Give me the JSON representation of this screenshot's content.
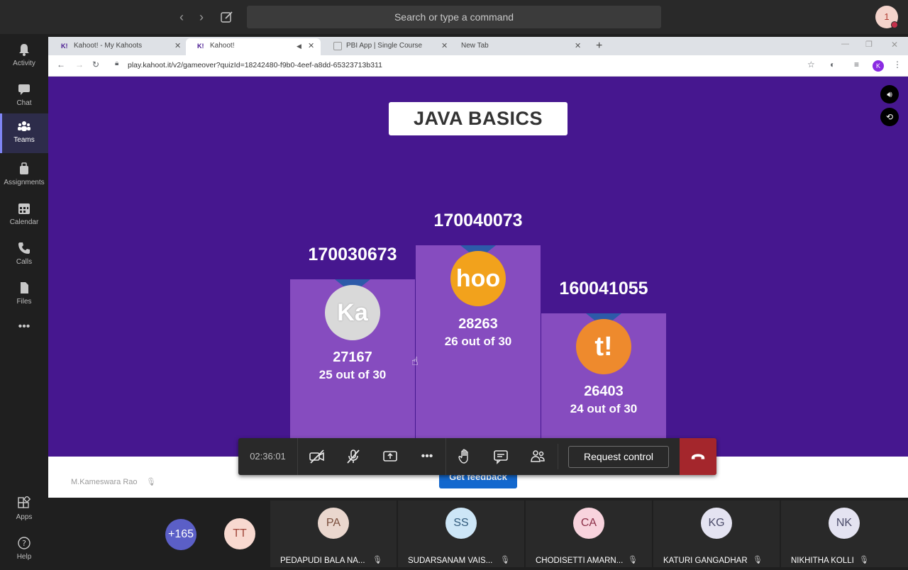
{
  "teams": {
    "search_placeholder": "Search or type a command",
    "avatar_initial": "1",
    "rail": [
      {
        "label": "Activity",
        "icon": "bell-icon"
      },
      {
        "label": "Chat",
        "icon": "chat-icon"
      },
      {
        "label": "Teams",
        "icon": "teams-icon",
        "active": true
      },
      {
        "label": "Assignments",
        "icon": "assignments-icon"
      },
      {
        "label": "Calendar",
        "icon": "calendar-icon"
      },
      {
        "label": "Calls",
        "icon": "phone-icon"
      },
      {
        "label": "Files",
        "icon": "files-icon"
      },
      {
        "label": "Apps",
        "icon": "apps-icon"
      },
      {
        "label": "Help",
        "icon": "help-icon"
      }
    ],
    "more_glyph": "•••"
  },
  "browser": {
    "tabs": [
      {
        "label": "Kahoot! - My Kahoots",
        "favicon": "K!"
      },
      {
        "label": "Kahoot!",
        "favicon": "K!"
      },
      {
        "label": "PBI App | Single Course",
        "favicon": ""
      },
      {
        "label": "New Tab",
        "favicon": ""
      }
    ],
    "url": "play.kahoot.it/v2/gameover?quizId=18242480-f9b0-4eef-a8dd-65323713b311",
    "profile_initial": "K"
  },
  "kahoot": {
    "quiz_title": "JAVA BASICS",
    "podium": [
      {
        "place": 2,
        "name": "170030673",
        "score": "27167",
        "correct": "25 out of 30",
        "medal_text": "Ka",
        "medal_color": "#d9d9d9"
      },
      {
        "place": 1,
        "name": "170040073",
        "score": "28263",
        "correct": "26 out of 30",
        "medal_text": "hoo",
        "medal_color": "#f2a21c"
      },
      {
        "place": 3,
        "name": "160041055",
        "score": "26403",
        "correct": "24 out of 30",
        "medal_text": "t!",
        "medal_color": "#ee8a2d"
      }
    ],
    "feedback_label": "Get feedback",
    "presenter": "M.Kameswara Rao"
  },
  "meeting": {
    "timer": "02:36:01",
    "request_control_label": "Request control",
    "participants": [
      {
        "initials": "+165",
        "name": "",
        "color": "#5b5fc7"
      },
      {
        "initials": "TT",
        "name": "",
        "color": "#f8d9d0"
      },
      {
        "initials": "PA",
        "name": "PEDAPUDI BALA NA...",
        "color": "#ead7ce"
      },
      {
        "initials": "SS",
        "name": "SUDARSANAM VAIS...",
        "color": "#cde6f7"
      },
      {
        "initials": "CA",
        "name": "CHODISETTI AMARN...",
        "color": "#f8d3dd"
      },
      {
        "initials": "KG",
        "name": "KATURI GANGADHAR",
        "color": "#e4e3f1"
      },
      {
        "initials": "NK",
        "name": "NIKHITHA KOLLI",
        "color": "#e4e3f1"
      }
    ]
  },
  "colors": {
    "kahoot_purple": "#46178f",
    "podium_purple": "#864cbf",
    "teams_accent": "#7f85f5",
    "hangup_red": "#a4262c"
  }
}
